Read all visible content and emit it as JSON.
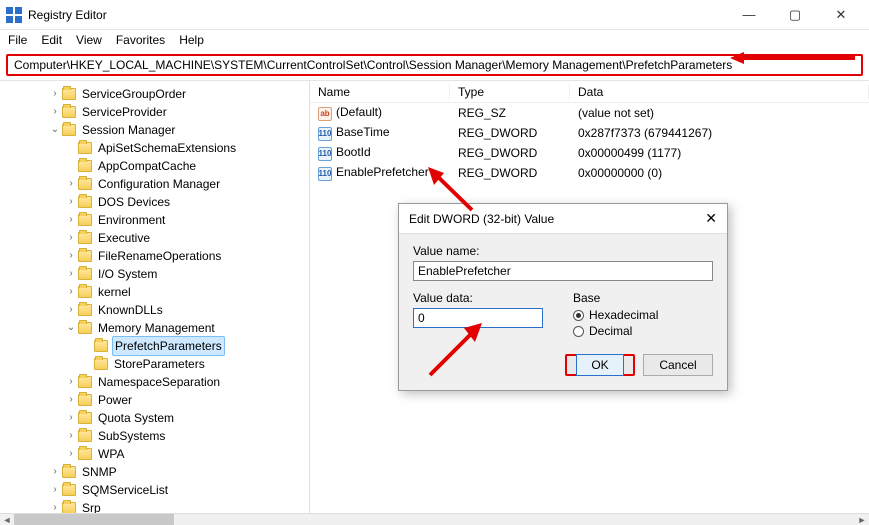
{
  "window": {
    "title": "Registry Editor"
  },
  "menus": {
    "file": "File",
    "edit": "Edit",
    "view": "View",
    "favorites": "Favorites",
    "help": "Help"
  },
  "address": "Computer\\HKEY_LOCAL_MACHINE\\SYSTEM\\CurrentControlSet\\Control\\Session Manager\\Memory Management\\PrefetchParameters",
  "tree": [
    {
      "indent": 3,
      "expander": ">",
      "label": "ServiceGroupOrder"
    },
    {
      "indent": 3,
      "expander": ">",
      "label": "ServiceProvider"
    },
    {
      "indent": 3,
      "expander": "v",
      "label": "Session Manager"
    },
    {
      "indent": 4,
      "expander": "",
      "label": "ApiSetSchemaExtensions"
    },
    {
      "indent": 4,
      "expander": "",
      "label": "AppCompatCache"
    },
    {
      "indent": 4,
      "expander": ">",
      "label": "Configuration Manager"
    },
    {
      "indent": 4,
      "expander": ">",
      "label": "DOS Devices"
    },
    {
      "indent": 4,
      "expander": ">",
      "label": "Environment"
    },
    {
      "indent": 4,
      "expander": ">",
      "label": "Executive"
    },
    {
      "indent": 4,
      "expander": ">",
      "label": "FileRenameOperations"
    },
    {
      "indent": 4,
      "expander": ">",
      "label": "I/O System"
    },
    {
      "indent": 4,
      "expander": ">",
      "label": "kernel"
    },
    {
      "indent": 4,
      "expander": ">",
      "label": "KnownDLLs"
    },
    {
      "indent": 4,
      "expander": "v",
      "label": "Memory Management"
    },
    {
      "indent": 5,
      "expander": "",
      "label": "PrefetchParameters",
      "selected": true
    },
    {
      "indent": 5,
      "expander": "",
      "label": "StoreParameters"
    },
    {
      "indent": 4,
      "expander": ">",
      "label": "NamespaceSeparation"
    },
    {
      "indent": 4,
      "expander": ">",
      "label": "Power"
    },
    {
      "indent": 4,
      "expander": ">",
      "label": "Quota System"
    },
    {
      "indent": 4,
      "expander": ">",
      "label": "SubSystems"
    },
    {
      "indent": 4,
      "expander": ">",
      "label": "WPA"
    },
    {
      "indent": 3,
      "expander": ">",
      "label": "SNMP"
    },
    {
      "indent": 3,
      "expander": ">",
      "label": "SQMServiceList"
    },
    {
      "indent": 3,
      "expander": ">",
      "label": "Srp"
    }
  ],
  "list": {
    "headers": {
      "name": "Name",
      "type": "Type",
      "data": "Data"
    },
    "rows": [
      {
        "icon": "str",
        "name": "(Default)",
        "type": "REG_SZ",
        "data": "(value not set)"
      },
      {
        "icon": "bin",
        "name": "BaseTime",
        "type": "REG_DWORD",
        "data": "0x287f7373 (679441267)"
      },
      {
        "icon": "bin",
        "name": "BootId",
        "type": "REG_DWORD",
        "data": "0x00000499 (1177)"
      },
      {
        "icon": "bin",
        "name": "EnablePrefetcher",
        "type": "REG_DWORD",
        "data": "0x00000000 (0)"
      }
    ]
  },
  "dialog": {
    "title": "Edit DWORD (32-bit) Value",
    "valuename_label": "Value name:",
    "valuename": "EnablePrefetcher",
    "valuedata_label": "Value data:",
    "valuedata": "0",
    "base_label": "Base",
    "base_hex": "Hexadecimal",
    "base_dec": "Decimal",
    "ok": "OK",
    "cancel": "Cancel"
  }
}
